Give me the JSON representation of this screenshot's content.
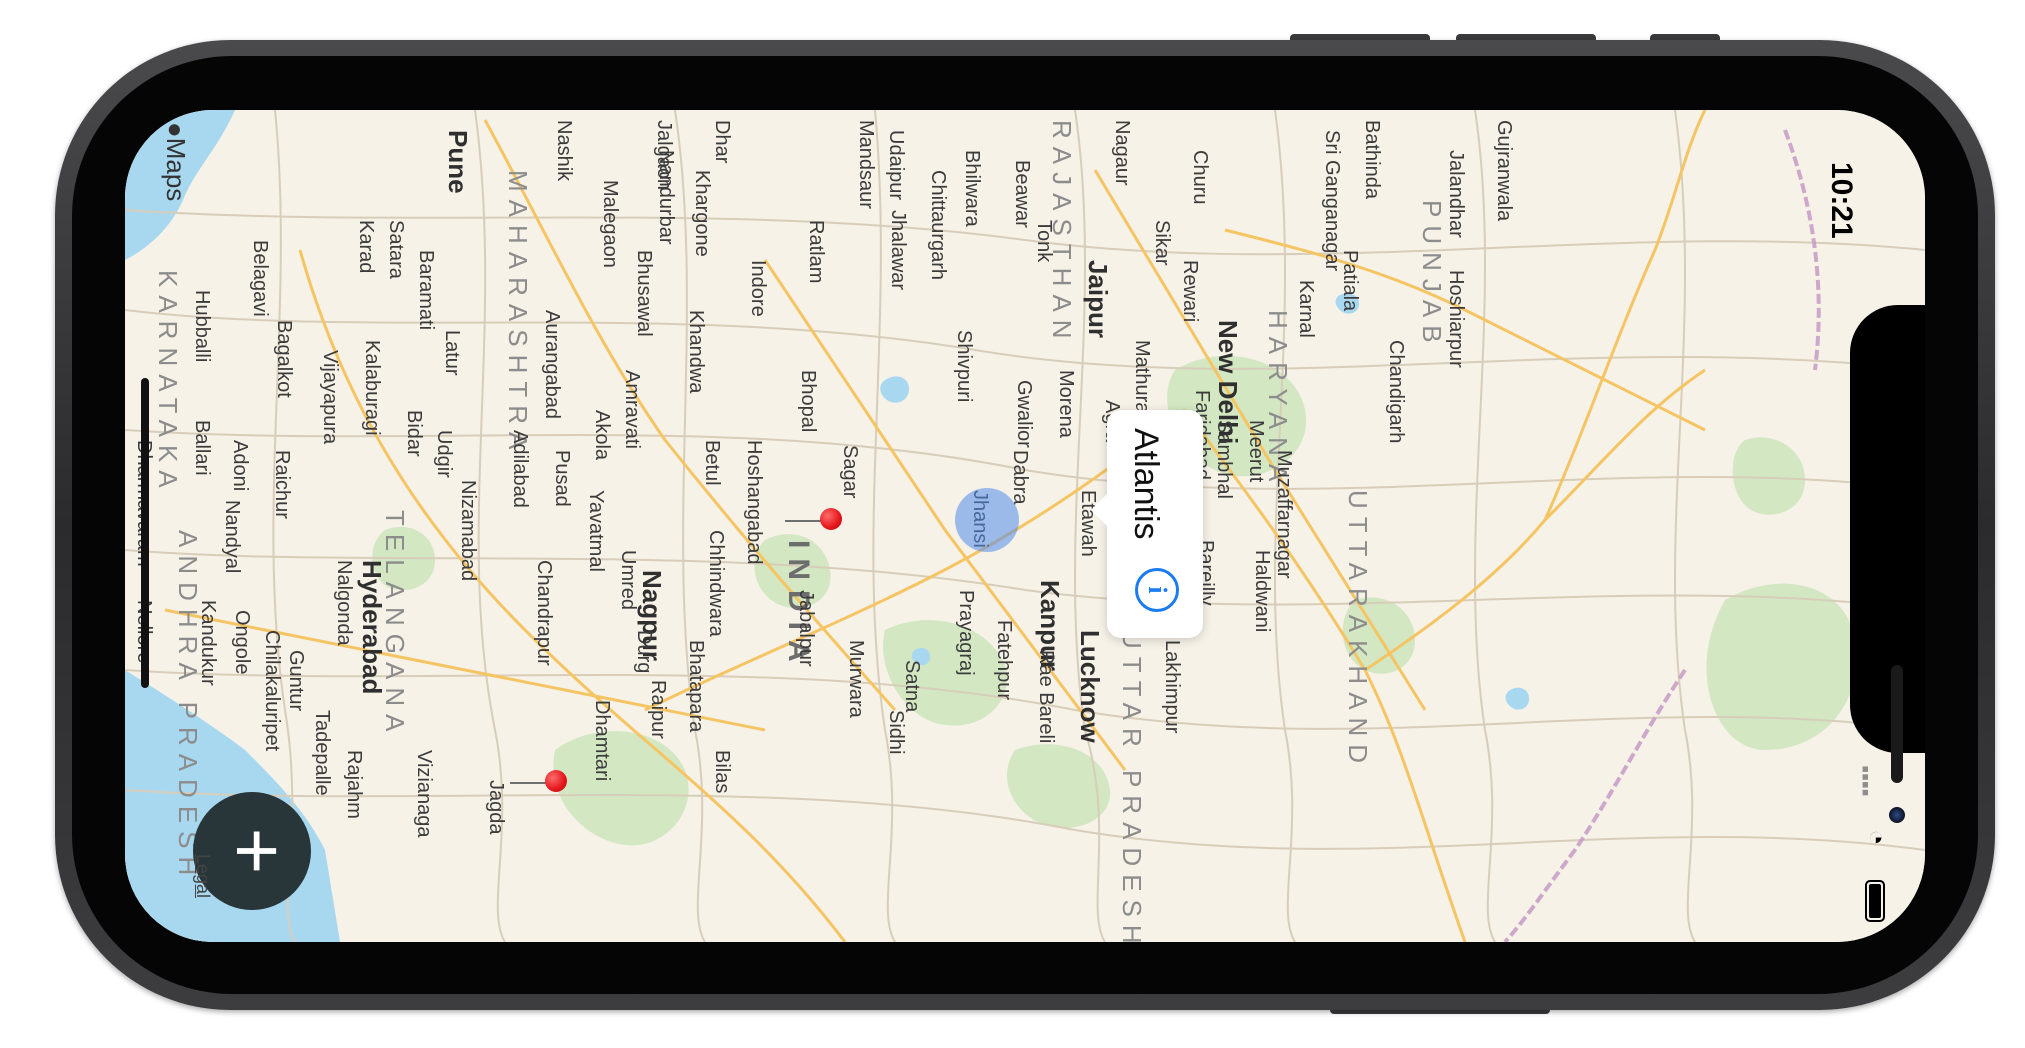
{
  "device": {
    "model": "iPhone (landscape)"
  },
  "app": {
    "brand": "Maps",
    "legal_link": "Legal"
  },
  "status_bar": {
    "time": "10:21",
    "signal": "▪▪▪▪",
    "wifi_icon": "wifi-icon",
    "battery_icon": "battery-icon"
  },
  "add_button": {
    "icon": "plus-icon",
    "label": "+"
  },
  "callout": {
    "title": "Atlantis",
    "info_icon": "info-icon",
    "info_glyph": "i"
  },
  "colors": {
    "land": "#f6f2e8",
    "water": "#a8d8f0",
    "park": "#cfe5bf",
    "highway": "#f5c463",
    "road": "#cfc4b2",
    "state_border": "#c9a0c8",
    "pin": "#e3161b",
    "user_location": "#5a8ee9",
    "add_button": "#28363a",
    "info_blue": "#1a7cf0"
  },
  "map": {
    "country_labels": [
      "INDIA"
    ],
    "region_labels": [
      "KARNATAKA",
      "MAHARASHTRA",
      "TELANGANA",
      "ANDHRA PRADESH",
      "RAJASTHAN",
      "HARYANA",
      "PUNJAB",
      "UTTARAKHAND",
      "UTTAR PRADESH"
    ],
    "major_cities": [
      "Pune",
      "Hyderabad",
      "Nagpur",
      "Jaipur",
      "New Delhi",
      "Kanpur",
      "Lucknow"
    ],
    "cities": [
      "Belagavi",
      "Hubballi",
      "Bagalkot",
      "Karad",
      "Satara",
      "Baramati",
      "Vijayapura",
      "Kalaburagi",
      "Latur",
      "Bidar",
      "Udgir",
      "Raichur",
      "Adoni",
      "Ballari",
      "Nashik",
      "Aurangabad",
      "Malegaon",
      "Jalgaon",
      "Nandurbar",
      "Bhusawal",
      "Khargone",
      "Indore",
      "Ratlam",
      "Mandsaur",
      "Udaipur",
      "Chittaurgarh",
      "Bhilwara",
      "Jhalawar",
      "Bhopal",
      "Khandwa",
      "Amravati",
      "Akola",
      "Adilabad",
      "Pusad",
      "Yavatmal",
      "Nizamabad",
      "Hoshangabad",
      "Betul",
      "Chhindwara",
      "Sagar",
      "Nalgonda",
      "Nandyal",
      "Dharmavaram",
      "Kandukur",
      "Ongole",
      "Nellore",
      "Chilakaluripet",
      "Guntur",
      "Tadepalle",
      "Rajahm",
      "Vizianaga",
      "Jagda",
      "Chandrapur",
      "Umred",
      "Durg",
      "Raipur",
      "Dhamtari",
      "Bhatapara",
      "Jabalpur",
      "Murwara",
      "Satna",
      "Sidhi",
      "Bilas",
      "Gwalior",
      "Dabra",
      "Jhansi",
      "Morena",
      "Agra",
      "Mathura",
      "Aligarh",
      "Faridabad",
      "Sambhal",
      "Meerut",
      "Muzaffarnagar",
      "Haldwani",
      "Bareilly",
      "Lakhimpur",
      "Etawah",
      "Fatehpur",
      "Rae Bareli",
      "Prayagraj",
      "Shivpuri",
      "Beawar",
      "Tonk",
      "Nagaur",
      "Churu",
      "Sikar",
      "Rewari",
      "Sri Ganganagar",
      "Bathinda",
      "Jalandhar",
      "Patiala",
      "Karnal",
      "Chandigarh",
      "Hoshiarpur",
      "Gujranwala",
      "Dhar"
    ]
  }
}
